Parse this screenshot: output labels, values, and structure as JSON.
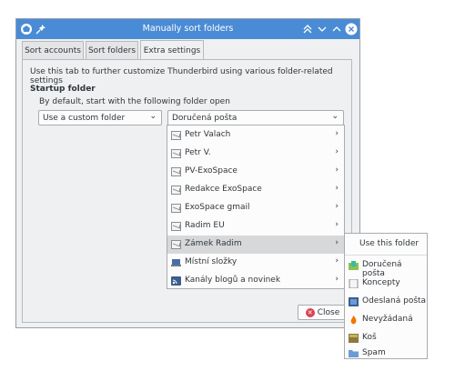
{
  "window": {
    "title": "Manually sort folders",
    "tabs": [
      {
        "label": "Sort accounts",
        "active": false
      },
      {
        "label": "Sort folders",
        "active": false
      },
      {
        "label": "Extra settings",
        "active": true
      }
    ]
  },
  "extra_settings": {
    "description": "Use this tab to further customize Thunderbird using various folder-related settings",
    "section_title": "Startup folder",
    "subdescription": "By default, start with the following folder open",
    "mode_select": {
      "value": "Use a custom folder"
    },
    "folder_select": {
      "value": "Doručená pošta"
    }
  },
  "close_button": {
    "label": "Close"
  },
  "folder_menu": {
    "items": [
      {
        "label": "Petr Valach",
        "icon": "mail-account-icon"
      },
      {
        "label": "Petr V.",
        "icon": "mail-account-icon"
      },
      {
        "label": "PV-ExoSpace",
        "icon": "mail-account-icon"
      },
      {
        "label": "Redakce ExoSpace",
        "icon": "mail-account-icon"
      },
      {
        "label": "ExoSpace gmail",
        "icon": "mail-account-icon"
      },
      {
        "label": "Radim EU",
        "icon": "mail-account-icon"
      },
      {
        "label": "Zámek Radim",
        "icon": "mail-account-icon",
        "highlighted": true
      },
      {
        "label": "Místní složky",
        "icon": "local-folders-icon"
      },
      {
        "label": "Kanály blogů a novinek",
        "icon": "feeds-icon"
      }
    ]
  },
  "submenu": {
    "header": "Use this folder",
    "items": [
      {
        "label": "Doručená pošta",
        "icon": "inbox-icon"
      },
      {
        "label": "Koncepty",
        "icon": "drafts-icon"
      },
      {
        "label": "Odeslaná pošta",
        "icon": "sent-icon"
      },
      {
        "label": "Nevyžádaná",
        "icon": "junk-icon"
      },
      {
        "label": "Koš",
        "icon": "trash-icon"
      },
      {
        "label": "Spam",
        "icon": "folder-icon"
      }
    ]
  },
  "colors": {
    "titlebar": "#4a8bd5",
    "highlight": "#d6d8da",
    "close_icon": "#da4453"
  }
}
